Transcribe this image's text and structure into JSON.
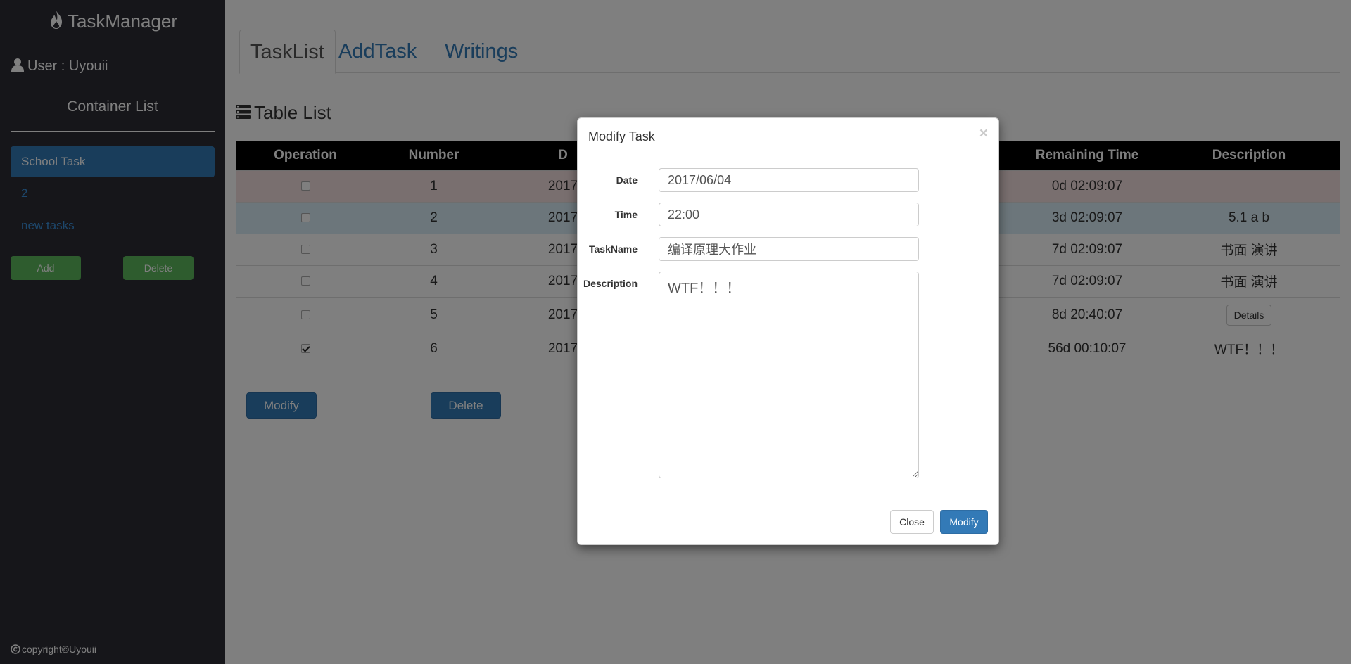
{
  "app": {
    "title": "TaskManager"
  },
  "sidebar": {
    "user_label": "User : Uyouii",
    "container_title": "Container List",
    "items": [
      {
        "label": "School Task",
        "active": true
      },
      {
        "label": "2",
        "active": false
      },
      {
        "label": "new tasks",
        "active": false
      }
    ],
    "add_label": "Add",
    "delete_label": "Delete",
    "copyright": "copyright©Uyouii"
  },
  "tabs": [
    {
      "label": "TaskList",
      "active": true
    },
    {
      "label": "AddTask",
      "active": false
    },
    {
      "label": "Writings",
      "active": false
    }
  ],
  "table": {
    "heading": "Table List",
    "columns": {
      "operation": "Operation",
      "number": "Number",
      "date": "D",
      "remaining": "Remaining Time",
      "description": "Description"
    },
    "rows": [
      {
        "checked": false,
        "number": "1",
        "date": "2017",
        "remaining": "0d 02:09:07",
        "description": ""
      },
      {
        "checked": false,
        "number": "2",
        "date": "2017",
        "remaining": "3d 02:09:07",
        "description": "5.1 a b"
      },
      {
        "checked": false,
        "number": "3",
        "date": "2017",
        "remaining": "7d 02:09:07",
        "description": "书面 演讲"
      },
      {
        "checked": false,
        "number": "4",
        "date": "2017",
        "remaining": "7d 02:09:07",
        "description": "书面 演讲"
      },
      {
        "checked": false,
        "number": "5",
        "date": "2017",
        "remaining": "8d 20:40:07",
        "description": "Details"
      },
      {
        "checked": true,
        "number": "6",
        "date": "2017",
        "remaining": "56d 00:10:07",
        "description": "WTF！！！"
      }
    ],
    "modify_label": "Modify",
    "delete_label": "Delete"
  },
  "modal": {
    "title": "Modify Task",
    "close_x": "×",
    "fields": {
      "date_label": "Date",
      "date_value": "2017/06/04",
      "time_label": "Time",
      "time_value": "22:00",
      "taskname_label": "TaskName",
      "taskname_value": "编译原理大作业",
      "description_label": "Description",
      "description_value": "WTF！！！"
    },
    "close_label": "Close",
    "submit_label": "Modify"
  },
  "icons": {
    "brand": "flame-icon",
    "user": "user-icon",
    "table_list": "tasks-icon",
    "copyright": "copyright-icon"
  },
  "colors": {
    "sidebar_bg": "#2c2c35",
    "primary": "#337ab7",
    "success": "#5cb85c",
    "row_danger": "#f2dede",
    "row_info": "#d9edf7"
  }
}
